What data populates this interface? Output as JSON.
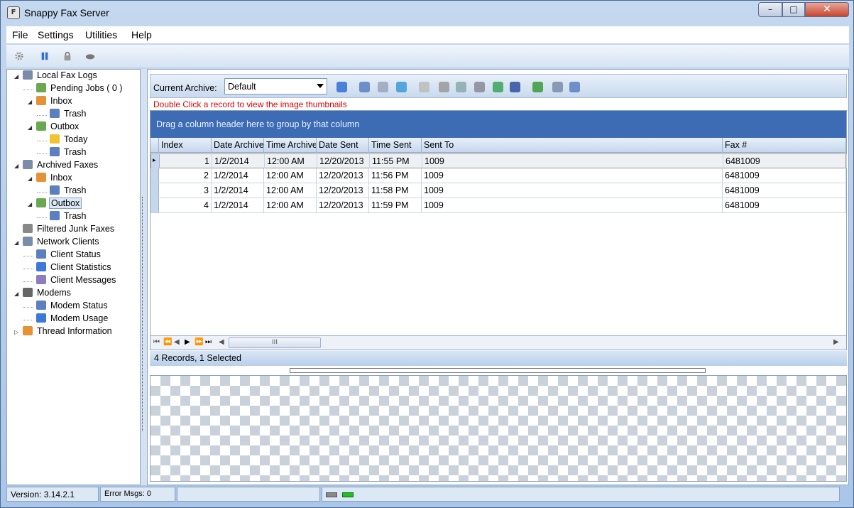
{
  "window": {
    "title": "Snappy Fax Server",
    "app_icon": "fax-icon",
    "min": "–",
    "max": "□",
    "close": "✕"
  },
  "menu": [
    "File",
    "Settings",
    "Utilities",
    "Help"
  ],
  "toolbar_icons": [
    "gear-icon",
    "pause-icon",
    "lock-icon",
    "modem-icon"
  ],
  "tree": [
    {
      "label": "Local Fax Logs",
      "icon": "server-icon",
      "color": "#7a8ca8",
      "level": 0,
      "expanded": true
    },
    {
      "label": "Pending Jobs ( 0 )",
      "icon": "document-clock-icon",
      "color": "#6aa84f",
      "level": 1
    },
    {
      "label": "Inbox",
      "icon": "inbox-icon",
      "color": "#e69138",
      "level": 1,
      "expanded": true
    },
    {
      "label": "Trash",
      "icon": "trash-icon",
      "color": "#5b7fbf",
      "level": 2
    },
    {
      "label": "Outbox",
      "icon": "outbox-icon",
      "color": "#6aa84f",
      "level": 1,
      "expanded": true
    },
    {
      "label": "Today",
      "icon": "folder-icon",
      "color": "#f1c232",
      "level": 2
    },
    {
      "label": "Trash",
      "icon": "trash-icon",
      "color": "#5b7fbf",
      "level": 2
    },
    {
      "label": "Archived Faxes",
      "icon": "archive-icon",
      "color": "#7a8ca8",
      "level": 0,
      "expanded": true
    },
    {
      "label": "Inbox",
      "icon": "inbox-icon",
      "color": "#e69138",
      "level": 1,
      "expanded": true
    },
    {
      "label": "Trash",
      "icon": "trash-icon",
      "color": "#5b7fbf",
      "level": 2
    },
    {
      "label": "Outbox",
      "icon": "outbox-icon",
      "color": "#6aa84f",
      "level": 1,
      "expanded": true,
      "selected": true
    },
    {
      "label": "Trash",
      "icon": "trash-icon",
      "color": "#5b7fbf",
      "level": 2
    },
    {
      "label": "Filtered Junk Faxes",
      "icon": "filter-icon",
      "color": "#888888",
      "level": 0
    },
    {
      "label": "Network Clients",
      "icon": "network-icon",
      "color": "#7a8ca8",
      "level": 0,
      "expanded": true
    },
    {
      "label": "Client Status",
      "icon": "status-icon",
      "color": "#5b7fbf",
      "level": 1
    },
    {
      "label": "Client Statistics",
      "icon": "statistics-icon",
      "color": "#3c78d8",
      "level": 1
    },
    {
      "label": "Client Messages",
      "icon": "messages-icon",
      "color": "#8e7cc3",
      "level": 1
    },
    {
      "label": "Modems",
      "icon": "modem-icon",
      "color": "#666666",
      "level": 0,
      "expanded": true
    },
    {
      "label": "Modem  Status",
      "icon": "status-icon",
      "color": "#5b7fbf",
      "level": 1
    },
    {
      "label": "Modem  Usage",
      "icon": "statistics-icon",
      "color": "#3c78d8",
      "level": 1
    },
    {
      "label": "Thread Information",
      "icon": "thread-icon",
      "color": "#e69138",
      "level": 0,
      "expanded": false
    }
  ],
  "archive": {
    "label": "Current Archive:",
    "selected": "Default",
    "icons": [
      "user-icon",
      "recycle-icon",
      "image-icon",
      "share-icon",
      "new-document-icon",
      "delete-icon",
      "copy-icon",
      "print-icon",
      "approve-icon",
      "save-icon",
      "export-icon",
      "properties-icon",
      "list-icon"
    ],
    "hint": "Double Click a record to view the image thumbnails"
  },
  "grid": {
    "group_hint": "Drag a column header here to group by that column",
    "columns": [
      "Index",
      "Date Archived",
      "Time Archived",
      "Date Sent",
      "Time Sent",
      "Sent To",
      "Fax #"
    ],
    "rows": [
      [
        "1",
        "1/2/2014",
        "12:00 AM",
        "12/20/2013",
        "11:55 PM",
        "1009",
        "6481009"
      ],
      [
        "2",
        "1/2/2014",
        "12:00 AM",
        "12/20/2013",
        "11:56 PM",
        "1009",
        "6481009"
      ],
      [
        "3",
        "1/2/2014",
        "12:00 AM",
        "12/20/2013",
        "11:58 PM",
        "1009",
        "6481009"
      ],
      [
        "4",
        "1/2/2014",
        "12:00 AM",
        "12/20/2013",
        "11:59 PM",
        "1009",
        "6481009"
      ]
    ],
    "selected_row": 0,
    "nav": [
      "⏮",
      "⏪",
      "◀",
      "▶",
      "⏩",
      "⏭"
    ],
    "scroll_grip": "III",
    "record_summary": "4 Records, 1 Selected"
  },
  "status": {
    "version": "Version: 3.14.2.1",
    "errors": "Error Msgs: 0"
  }
}
